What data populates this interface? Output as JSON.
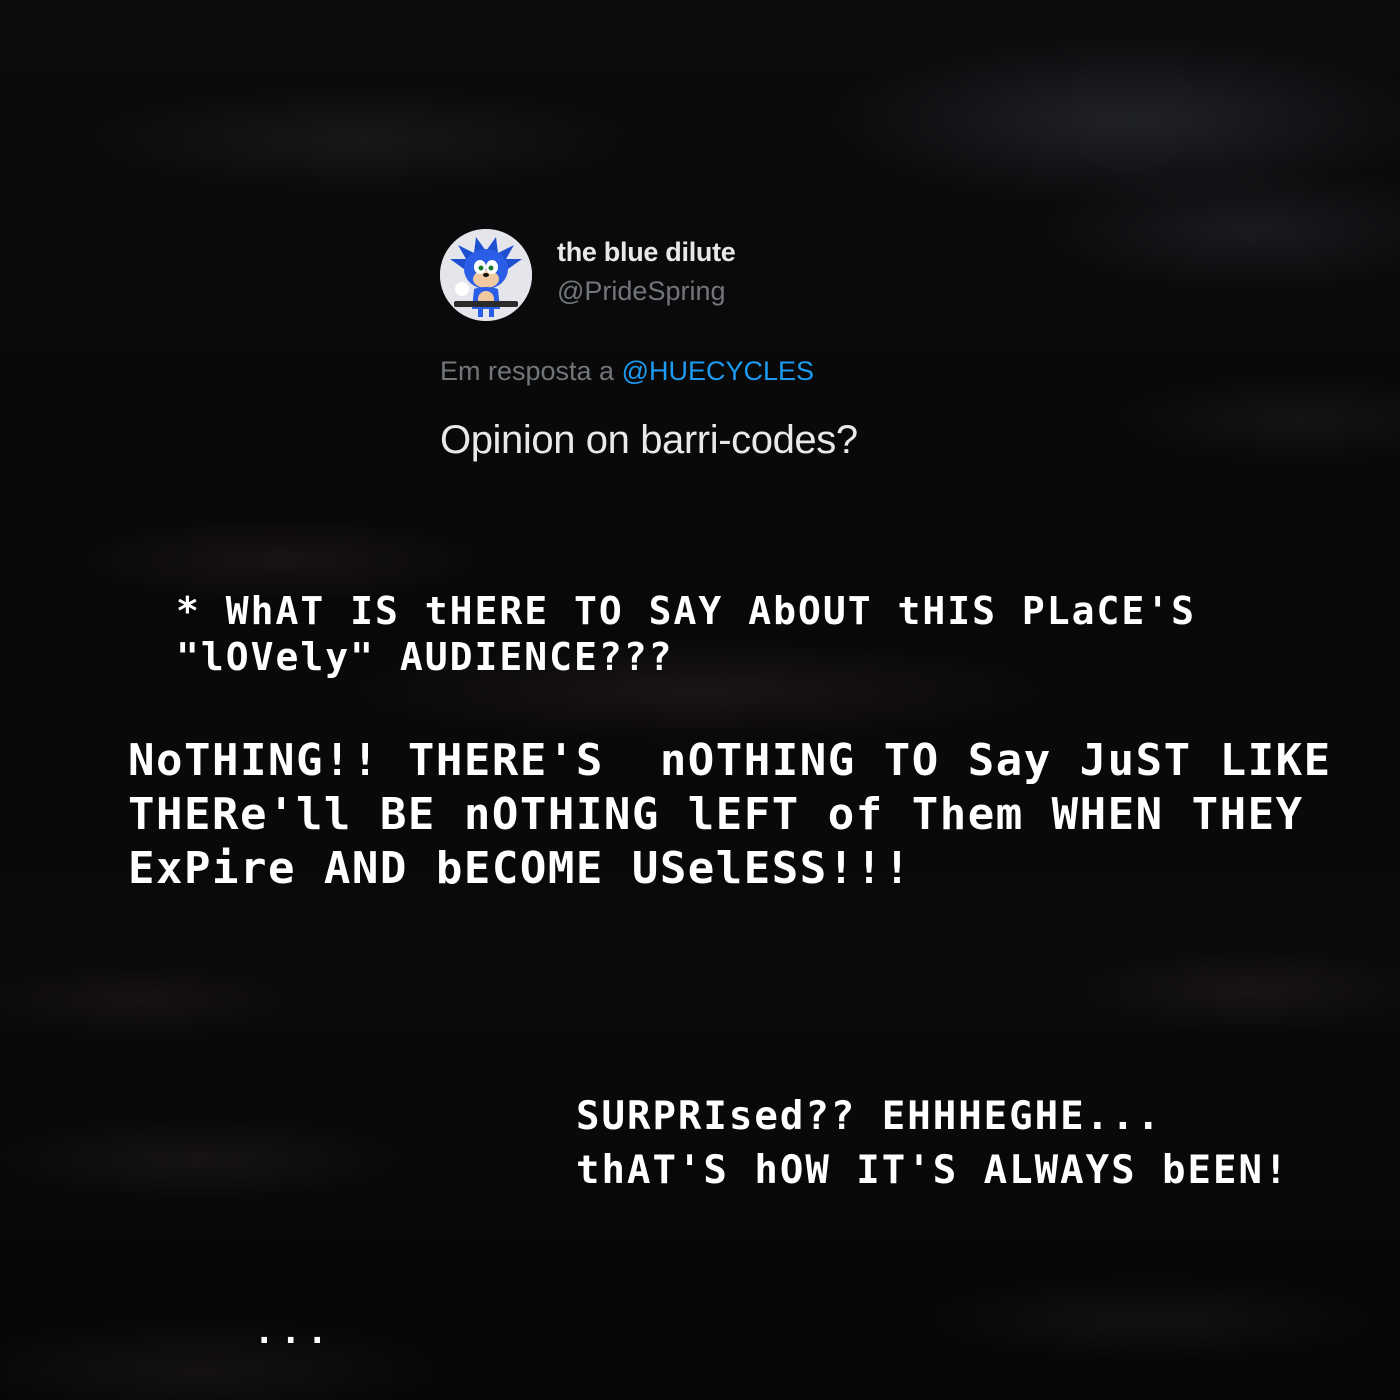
{
  "tweet": {
    "display_name": "the blue dilute",
    "handle": "@PrideSpring",
    "reply_prefix": "Em resposta a",
    "reply_mention": "@HUECYCLES",
    "text": "Opinion on barri-codes?",
    "avatar_icon": "sonic-character-avatar",
    "mention_color": "#1d9bf0"
  },
  "dialogue": {
    "line1": "* WhAT IS tHERE TO SAY AbOUT tHIS PLaCE'S\n\"lOVely\" AUDIENCE???",
    "line2": "NoTHING!! THERE'S  nOTHING TO Say JuST LIKE\nTHERe'll BE nOTHING lEFT of Them WHEN THEY\nExPire AND bECOME USelESS!!!",
    "line3": "SURPRIsed?? EHHHEGHE...\nthAT'S hOW IT'S ALWAYS bEEN!",
    "line4": "..."
  }
}
